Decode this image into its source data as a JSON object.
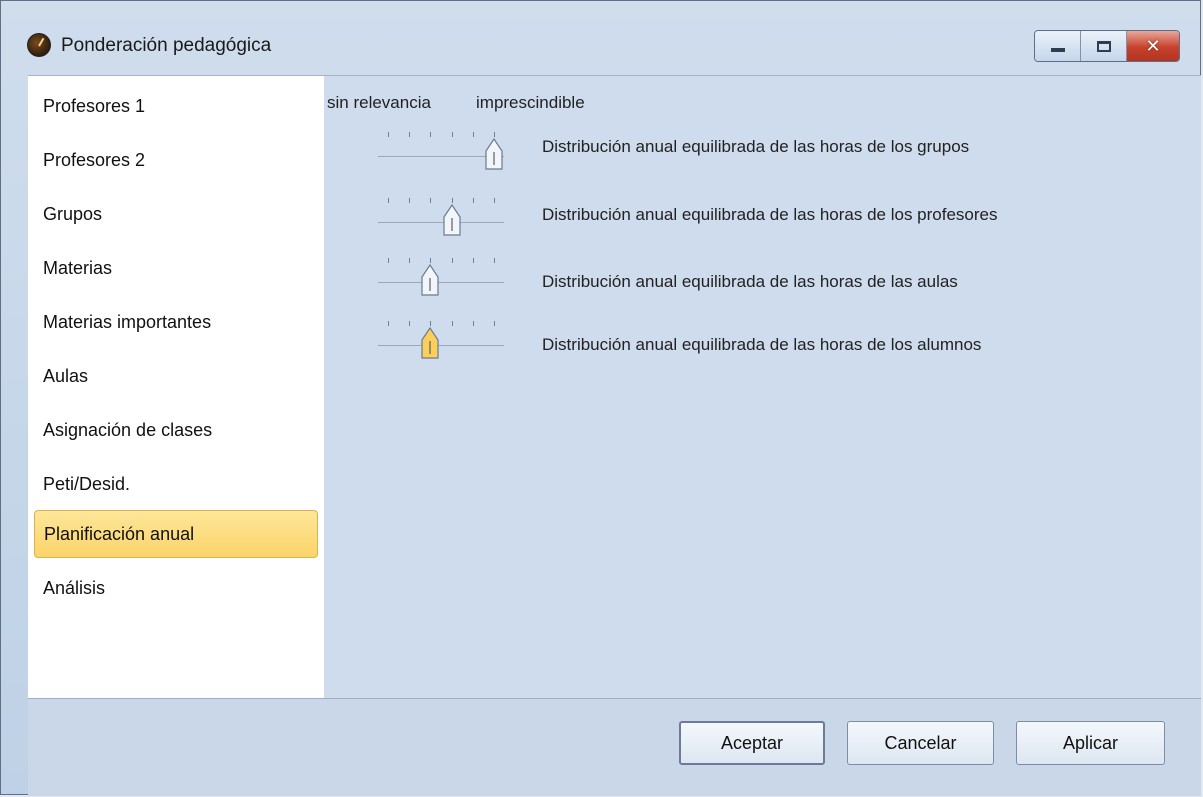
{
  "window": {
    "title": "Ponderación pedagógica"
  },
  "sidebar": {
    "items": [
      {
        "label": "Profesores 1"
      },
      {
        "label": "Profesores 2"
      },
      {
        "label": "Grupos"
      },
      {
        "label": "Materias"
      },
      {
        "label": "Materias importantes"
      },
      {
        "label": "Aulas"
      },
      {
        "label": "Asignación de clases"
      },
      {
        "label": "Peti/Desid."
      },
      {
        "label": "Planificación anual",
        "selected": true
      },
      {
        "label": "Análisis"
      }
    ]
  },
  "scale": {
    "low": "sin relevancia",
    "high": "imprescindible"
  },
  "sliders": [
    {
      "label": "Distribución anual equilibrada de las horas de los grupos",
      "level": 5,
      "max": 5
    },
    {
      "label": "Distribución anual equilibrada de las horas de los profesores",
      "level": 3,
      "max": 5
    },
    {
      "label": "Distribución anual equilibrada de las horas de las aulas",
      "level": 2,
      "max": 5
    },
    {
      "label": "Distribución anual equilibrada de las horas de los alumnos",
      "level": 2,
      "max": 5,
      "focused": true
    }
  ],
  "buttons": {
    "ok": "Aceptar",
    "cancel": "Cancelar",
    "apply": "Aplicar"
  },
  "colors": {
    "selection": "#fbd36a",
    "focus_thumb": "#fbcf5a"
  }
}
